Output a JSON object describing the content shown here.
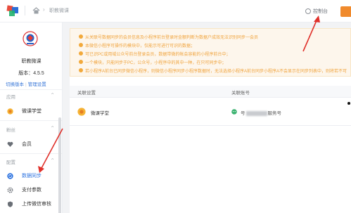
{
  "topbar": {
    "breadcrumb": "职教微课",
    "console_label": "控制台",
    "icons": {
      "logo": "colored-squares-logo",
      "home": "home-icon",
      "console": "gear-icon"
    }
  },
  "sidebar": {
    "app_name": "职教微课",
    "version": "版本：4.5.5",
    "links": {
      "switch_version": "切换版本",
      "manage_settings": "管理设置"
    },
    "groups": [
      {
        "title": "应用"
      },
      {
        "title": "粉丝"
      },
      {
        "title": "配置"
      }
    ],
    "items": [
      {
        "label": "微课学堂",
        "icon": "app-logo-icon"
      },
      {
        "label": "会员",
        "icon": "heart-icon"
      },
      {
        "label": "数据同步",
        "icon": "sync-icon",
        "active": true
      },
      {
        "label": "支付参数",
        "icon": "gear-icon"
      },
      {
        "label": "上传微信审核",
        "icon": "shield-icon"
      }
    ]
  },
  "notice": {
    "lines": [
      "从关联号数据同步的会员信息及小程序前台登录时金额判断为数据户成效无法识别同步一会员",
      "本微信小程序可操作的模块中，仅能示可进行可识的数据；",
      "可已识PC或用域公众号前台登录会员，数据带微的帐会容能的小程序前台中；",
      "一个模块，只能同步于PC，公众号，小程序中的其中一种，在只可同步中；",
      "若小程序A前台已同步微信小程序，则微信小程序同步小程序数据时，无法选择小程序A前台同步小程序A不会显示在同步列表中，则将若不可"
    ],
    "warning_color": "#f2a93b"
  },
  "table": {
    "headers": [
      "关联设置",
      "关联账号"
    ],
    "rows": [
      {
        "name": "微课学堂",
        "account_prefix": "号",
        "account_suffix": "服务号"
      }
    ]
  },
  "colors": {
    "accent": "#2f74e0",
    "annotation": "#e0312b"
  }
}
